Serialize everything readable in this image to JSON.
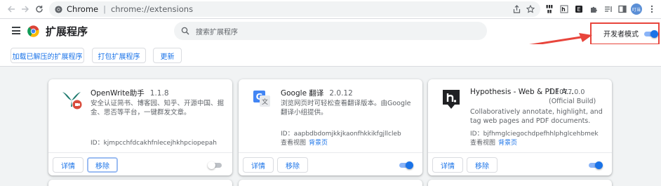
{
  "browser": {
    "omnibox": {
      "host": "Chrome",
      "separator": "|",
      "url": "chrome://extensions"
    },
    "avatar_text": "叮当"
  },
  "header": {
    "title": "扩展程序",
    "search_placeholder": "搜索扩展程序",
    "developer_mode": {
      "label": "开发者模式",
      "enabled": true
    }
  },
  "actions": {
    "load_unpacked": "加载已解压的扩展程序",
    "pack": "打包扩展程序",
    "update": "更新"
  },
  "extensions": [
    {
      "name": "OpenWrite助手",
      "version": "1.1.8",
      "description": "安全认证简书、博客园、知乎、开源中国、掘金、思否等平台，一键群发文章。",
      "id_label": "ID：",
      "id": "kjmpcchfdcakhfnlecejhkhpciopepah",
      "details_label": "详情",
      "remove_label": "移除",
      "enabled": false
    },
    {
      "name": "Google 翻译",
      "version": "2.0.12",
      "description": "浏览网页时可轻松查看翻译版本。由Google翻译小组提供。",
      "id_label": "ID：",
      "id": "aapbdbdomjkkjkaonfhkkikfgjllcleb",
      "views_label": "查看视图",
      "views_link": "背景页",
      "details_label": "详情",
      "remove_label": "移除",
      "enabled": true
    },
    {
      "name": "Hypothesis - Web & PDF A...",
      "version": "1.1077.0.0 (Official Build)",
      "description": "Collaboratively annotate, highlight, and tag web pages and PDF documents.",
      "id_label": "ID：",
      "id": "bjfhmglciegochdpefhhlphglcehbmek",
      "views_label": "查看视图",
      "views_link": "背景页",
      "details_label": "详情",
      "remove_label": "移除",
      "enabled": true
    }
  ],
  "colors": {
    "accent": "#1a73e8",
    "annotation_red": "#e8453c"
  }
}
